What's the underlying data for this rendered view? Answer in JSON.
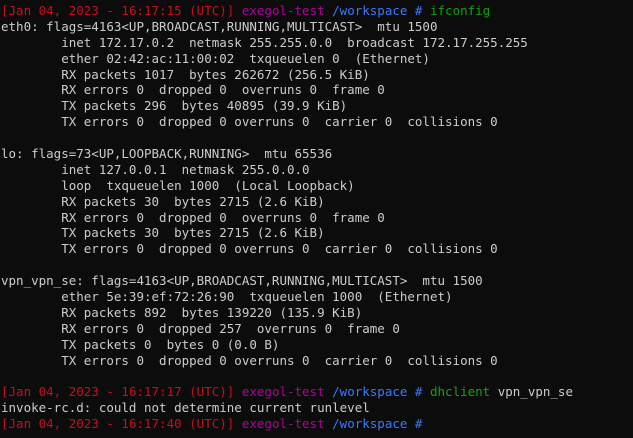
{
  "terminal": {
    "colors": {
      "background": "#0c0c0c",
      "foreground": "#cccccc",
      "prompt_bracket": "#c50f1f",
      "prompt_host": "#b4009e",
      "prompt_path": "#3b78ff",
      "command": "#13a10e"
    },
    "lines": [
      [
        {
          "t": "[",
          "c": "bracket"
        },
        {
          "t": "Jan 04, 2023 - 16:17:15 (UTC)",
          "c": "date"
        },
        {
          "t": "]",
          "c": "bracket"
        },
        {
          "t": " exegol-test",
          "c": "host"
        },
        {
          "t": " /workspace #",
          "c": "path"
        },
        {
          "t": " ifconfig",
          "c": "cmd"
        }
      ],
      [
        {
          "t": "eth0: flags=4163<UP,BROADCAST,RUNNING,MULTICAST>  mtu 1500",
          "c": "plain"
        }
      ],
      [
        {
          "t": "        inet 172.17.0.2  netmask 255.255.0.0  broadcast 172.17.255.255",
          "c": "plain"
        }
      ],
      [
        {
          "t": "        ether 02:42:ac:11:00:02  txqueuelen 0  (Ethernet)",
          "c": "plain"
        }
      ],
      [
        {
          "t": "        RX packets 1017  bytes 262672 (256.5 KiB)",
          "c": "plain"
        }
      ],
      [
        {
          "t": "        RX errors 0  dropped 0  overruns 0  frame 0",
          "c": "plain"
        }
      ],
      [
        {
          "t": "        TX packets 296  bytes 40895 (39.9 KiB)",
          "c": "plain"
        }
      ],
      [
        {
          "t": "        TX errors 0  dropped 0 overruns 0  carrier 0  collisions 0",
          "c": "plain"
        }
      ],
      [
        {
          "t": "",
          "c": "plain"
        }
      ],
      [
        {
          "t": "lo: flags=73<UP,LOOPBACK,RUNNING>  mtu 65536",
          "c": "plain"
        }
      ],
      [
        {
          "t": "        inet 127.0.0.1  netmask 255.0.0.0",
          "c": "plain"
        }
      ],
      [
        {
          "t": "        loop  txqueuelen 1000  (Local Loopback)",
          "c": "plain"
        }
      ],
      [
        {
          "t": "        RX packets 30  bytes 2715 (2.6 KiB)",
          "c": "plain"
        }
      ],
      [
        {
          "t": "        RX errors 0  dropped 0  overruns 0  frame 0",
          "c": "plain"
        }
      ],
      [
        {
          "t": "        TX packets 30  bytes 2715 (2.6 KiB)",
          "c": "plain"
        }
      ],
      [
        {
          "t": "        TX errors 0  dropped 0 overruns 0  carrier 0  collisions 0",
          "c": "plain"
        }
      ],
      [
        {
          "t": "",
          "c": "plain"
        }
      ],
      [
        {
          "t": "vpn_vpn_se: flags=4163<UP,BROADCAST,RUNNING,MULTICAST>  mtu 1500",
          "c": "plain"
        }
      ],
      [
        {
          "t": "        ether 5e:39:ef:72:26:90  txqueuelen 1000  (Ethernet)",
          "c": "plain"
        }
      ],
      [
        {
          "t": "        RX packets 892  bytes 139220 (135.9 KiB)",
          "c": "plain"
        }
      ],
      [
        {
          "t": "        RX errors 0  dropped 257  overruns 0  frame 0",
          "c": "plain"
        }
      ],
      [
        {
          "t": "        TX packets 0  bytes 0 (0.0 B)",
          "c": "plain"
        }
      ],
      [
        {
          "t": "        TX errors 0  dropped 0 overruns 0  carrier 0  collisions 0",
          "c": "plain"
        }
      ],
      [
        {
          "t": "",
          "c": "plain"
        }
      ],
      [
        {
          "t": "[",
          "c": "bracket"
        },
        {
          "t": "Jan 04, 2023 - 16:17:17 (UTC)",
          "c": "date"
        },
        {
          "t": "]",
          "c": "bracket"
        },
        {
          "t": " exegol-test",
          "c": "host"
        },
        {
          "t": " /workspace #",
          "c": "path"
        },
        {
          "t": " dhclient",
          "c": "cmd"
        },
        {
          "t": " vpn_vpn_se",
          "c": "arg"
        }
      ],
      [
        {
          "t": "invoke-rc.d: could not determine current runlevel",
          "c": "plain"
        }
      ],
      [
        {
          "t": "[",
          "c": "bracket"
        },
        {
          "t": "Jan 04, 2023 - 16:17:40 (UTC)",
          "c": "date"
        },
        {
          "t": "]",
          "c": "bracket"
        },
        {
          "t": " exegol-test",
          "c": "host"
        },
        {
          "t": " /workspace #",
          "c": "path"
        },
        {
          "t": " ",
          "c": "plain"
        }
      ]
    ]
  }
}
